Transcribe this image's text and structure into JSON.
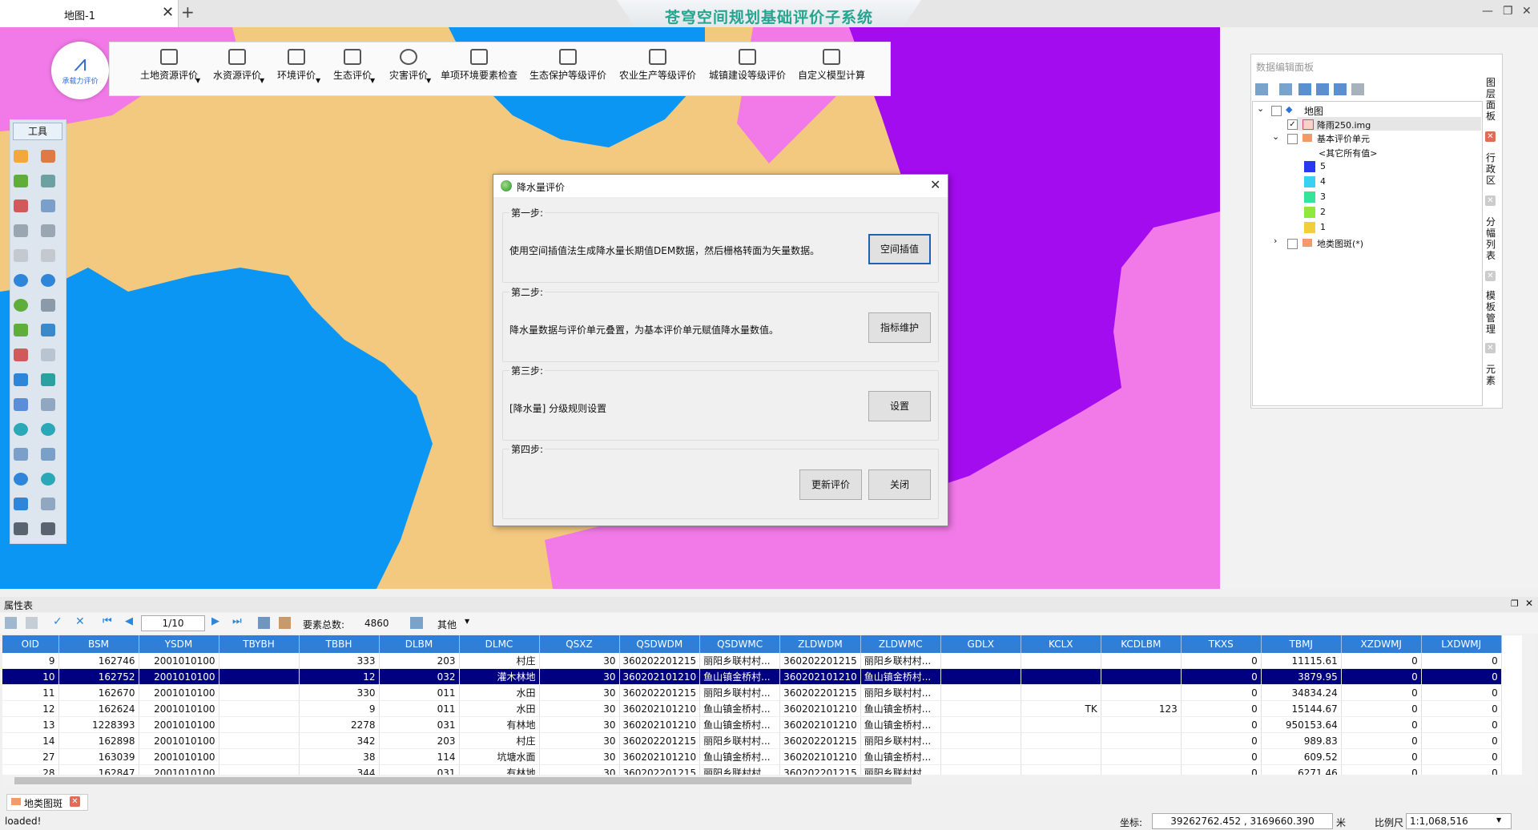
{
  "tab": {
    "label": "地图-1",
    "close": "✕",
    "add": "+"
  },
  "app_title": "苍穹空间规划基础评价子系统",
  "window_controls": {
    "minimize": "—",
    "restore": "❐",
    "close": "✕"
  },
  "logo": {
    "symbol": "⩘",
    "caption": "承载力评价"
  },
  "ribbon": [
    {
      "label": "土地资源评价",
      "dropdown": true
    },
    {
      "label": "水资源评价",
      "dropdown": true
    },
    {
      "label": "环境评价",
      "dropdown": true
    },
    {
      "label": "生态评价",
      "dropdown": true
    },
    {
      "label": "灾害评价",
      "dropdown": true
    },
    {
      "label": "单项环境要素检查",
      "dropdown": false
    },
    {
      "label": "生态保护等级评价",
      "dropdown": false
    },
    {
      "label": "农业生产等级评价",
      "dropdown": false
    },
    {
      "label": "城镇建设等级评价",
      "dropdown": false
    },
    {
      "label": "自定义模型计算",
      "dropdown": false
    }
  ],
  "toolbox": {
    "title": "工具"
  },
  "map_colors": {
    "base": "#f3c97f",
    "blue": "#0a96f2",
    "pink": "#f27ae8",
    "purple": "#a40cf0"
  },
  "dialog": {
    "title": "降水量评价",
    "close": "✕",
    "steps": [
      {
        "label": "第一步:",
        "text": "使用空间插值法生成降水量长期值DEM数据，然后栅格转面为矢量数据。",
        "button": "空间插值"
      },
      {
        "label": "第二步:",
        "text": "降水量数据与评价单元叠置，为基本评价单元赋值降水量数值。",
        "button": "指标维护"
      },
      {
        "label": "第三步:",
        "text": "[降水量] 分级规则设置",
        "button": "设置"
      },
      {
        "label": "第四步:",
        "text": "",
        "button": ""
      }
    ],
    "update_button": "更新评价",
    "close_button": "关闭"
  },
  "data_panel": {
    "title": "数据编辑面板",
    "tree": {
      "root": "地图",
      "layer_img": "降雨250.img",
      "group": "基本评价单元",
      "other": "<其它所有值>",
      "classes": [
        {
          "label": "5",
          "color": "#2a39f0"
        },
        {
          "label": "4",
          "color": "#39d0f2"
        },
        {
          "label": "3",
          "color": "#36e39a"
        },
        {
          "label": "2",
          "color": "#8fe83a"
        },
        {
          "label": "1",
          "color": "#f2cf3a"
        }
      ],
      "layer_land": "地类图斑(*)"
    },
    "vertical_tabs": [
      "图层面板",
      "行政区",
      "分幅列表",
      "模板管理",
      "元素"
    ]
  },
  "attr": {
    "title": "属性表",
    "page": "1/10",
    "total_label": "要素总数:",
    "total": "4860",
    "other": "其他",
    "columns": [
      "OID",
      "BSM",
      "YSDM",
      "TBYBH",
      "TBBH",
      "DLBM",
      "DLMC",
      "QSXZ",
      "QSDWDM",
      "QSDWMC",
      "ZLDWDM",
      "ZLDWMC",
      "GDLX",
      "KCLX",
      "KCDLBM",
      "TKXS",
      "TBMJ",
      "XZDWMJ",
      "LXDWMJ"
    ],
    "rows": [
      [
        "9",
        "162746",
        "2001010100",
        "",
        "333",
        "203",
        "村庄",
        "30",
        "360202201215",
        "丽阳乡联村村...",
        "360202201215",
        "丽阳乡联村村...",
        "",
        "",
        "",
        "0",
        "11115.61",
        "0",
        "0"
      ],
      [
        "10",
        "162752",
        "2001010100",
        "",
        "12",
        "032",
        "灌木林地",
        "30",
        "360202101210",
        "鱼山镇金桥村...",
        "360202101210",
        "鱼山镇金桥村...",
        "",
        "",
        "",
        "0",
        "3879.95",
        "0",
        "0"
      ],
      [
        "11",
        "162670",
        "2001010100",
        "",
        "330",
        "011",
        "水田",
        "30",
        "360202201215",
        "丽阳乡联村村...",
        "360202201215",
        "丽阳乡联村村...",
        "",
        "",
        "",
        "0",
        "34834.24",
        "0",
        "0"
      ],
      [
        "12",
        "162624",
        "2001010100",
        "",
        "9",
        "011",
        "水田",
        "30",
        "360202101210",
        "鱼山镇金桥村...",
        "360202101210",
        "鱼山镇金桥村...",
        "",
        "TK",
        "123",
        "0",
        "15144.67",
        "0",
        "0"
      ],
      [
        "13",
        "1228393",
        "2001010100",
        "",
        "2278",
        "031",
        "有林地",
        "30",
        "360202101210",
        "鱼山镇金桥村...",
        "360202101210",
        "鱼山镇金桥村...",
        "",
        "",
        "",
        "0",
        "950153.64",
        "0",
        "0"
      ],
      [
        "14",
        "162898",
        "2001010100",
        "",
        "342",
        "203",
        "村庄",
        "30",
        "360202201215",
        "丽阳乡联村村...",
        "360202201215",
        "丽阳乡联村村...",
        "",
        "",
        "",
        "0",
        "989.83",
        "0",
        "0"
      ],
      [
        "27",
        "163039",
        "2001010100",
        "",
        "38",
        "114",
        "坑塘水面",
        "30",
        "360202101210",
        "鱼山镇金桥村...",
        "360202101210",
        "鱼山镇金桥村...",
        "",
        "",
        "",
        "0",
        "609.52",
        "0",
        "0"
      ],
      [
        "28",
        "162847",
        "2001010100",
        "",
        "344",
        "031",
        "有林地",
        "30",
        "360202201215",
        "丽阳乡联村村...",
        "360202201215",
        "丽阳乡联村村...",
        "",
        "",
        "",
        "0",
        "6271.46",
        "0",
        "0"
      ]
    ],
    "selected_row": 1
  },
  "bottom_tab": "地类图斑",
  "status": {
    "text": "loaded!",
    "coord_label": "坐标:",
    "coord": "39262762.452 , 3169660.390",
    "unit": "米",
    "scale_label": "比例尺",
    "scale": "1:1,068,516"
  }
}
